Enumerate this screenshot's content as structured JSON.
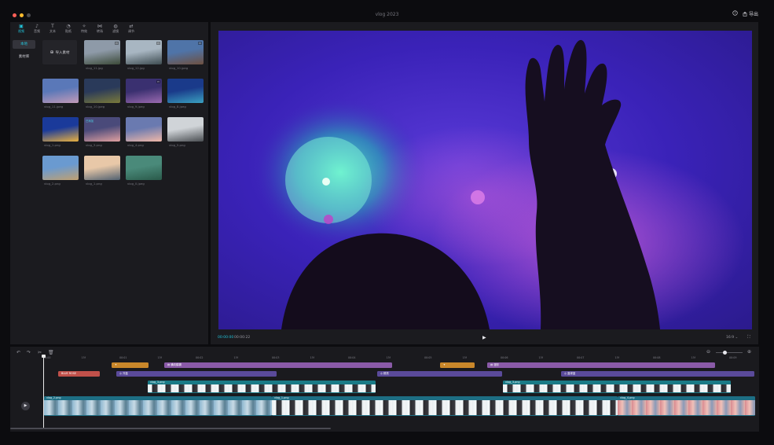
{
  "window": {
    "title": "vlog 2023",
    "help_icon": "question-icon",
    "export_label": "导出",
    "traffic_colors": [
      "#ff5f57",
      "#febc2e",
      "#4a4a4f"
    ]
  },
  "media": {
    "tools": [
      {
        "icon": "media-icon",
        "glyph": "▣",
        "label": "视频"
      },
      {
        "icon": "audio-icon",
        "glyph": "♪",
        "label": "音频"
      },
      {
        "icon": "text-icon",
        "glyph": "T",
        "label": "文本"
      },
      {
        "icon": "sticker-icon",
        "glyph": "◔",
        "label": "贴纸"
      },
      {
        "icon": "effects-icon",
        "glyph": "✧",
        "label": "特效"
      },
      {
        "icon": "transition-icon",
        "glyph": "⋈",
        "label": "转场"
      },
      {
        "icon": "filter-icon",
        "glyph": "◍",
        "label": "滤镜"
      },
      {
        "icon": "adjust-icon",
        "glyph": "⇄",
        "label": "调节"
      }
    ],
    "sidebar": [
      "本地",
      "素材库"
    ],
    "import_label": "导入素材",
    "thumbs": [
      {
        "name": "vlog_11.jpg",
        "c1": "#8e9aa8",
        "c2": "#3c4a38"
      },
      {
        "name": "vlog_12.jpg",
        "c1": "#a8b6c2",
        "c2": "#3d4b50"
      },
      {
        "name": "vlog_10.jpeg",
        "c1": "#4f74a8",
        "c2": "#6e5040"
      },
      {
        "name": "vlog_11.jpeg",
        "c1": "#5a78b8",
        "c2": "#c29ab8"
      },
      {
        "name": "vlog_10.jpeg",
        "c1": "#2a3a5a",
        "c2": "#7a7a3a"
      },
      {
        "name": "vlog_9.jpeg",
        "c1": "#3a3070",
        "c2": "#9a6ab0"
      },
      {
        "name": "vlog_8.jpeg",
        "c1": "#1a3a8a",
        "c2": "#3aa0c0"
      },
      {
        "name": "vlog_1.png",
        "c1": "#1a3a9a",
        "c2": "#e8b040"
      },
      {
        "name": "vlog_3.png",
        "c1": "#4a4a7a",
        "c2": "#e0a0a0"
      },
      {
        "name": "vlog_4.png",
        "c1": "#6a7ab0",
        "c2": "#f0b8a8"
      },
      {
        "name": "vlog_5.png",
        "c1": "#d0d4d8",
        "c2": "#4a4e52"
      },
      {
        "name": "vlog_2.png",
        "c1": "#6a9ad0",
        "c2": "#c0a070"
      },
      {
        "name": "vlog_1.png",
        "c1": "#e8c8a8",
        "c2": "#506070"
      },
      {
        "name": "vlog_0.jpeg",
        "c1": "#4a8a7a",
        "c2": "#2a5a4a"
      }
    ],
    "used_badge": "已添加"
  },
  "preview": {
    "time_current": "00:00:00",
    "time_total": "00:00:22",
    "ratio": "16:9",
    "play_icon": "play-icon",
    "fullscreen_icon": "fullscreen-icon"
  },
  "timeline": {
    "ruler": [
      "00:00",
      "15f",
      "00:01",
      "15f",
      "00:02",
      "15f",
      "00:03",
      "15f",
      "00:04",
      "15f",
      "00:05",
      "15f",
      "00:06",
      "15f",
      "00:07",
      "15f",
      "00:08",
      "15f",
      "00:09"
    ],
    "tracks": {
      "row1": [
        {
          "label": "✦",
          "color": "#c9872a"
        },
        {
          "label": "▤ 横向模糊",
          "color": "#8a5aa8"
        },
        {
          "label": "✦",
          "color": "#c9872a"
        },
        {
          "label": "▤ 漫彩",
          "color": "#8a5aa8"
        }
      ],
      "row2": [
        {
          "label": "BLUE ROSE",
          "color": "#c0504a"
        },
        {
          "label": "◎ 冷蓝",
          "color": "#5a4a9a"
        },
        {
          "label": "◎ 鲜亮",
          "color": "#5a4a9a"
        },
        {
          "label": "◎ 蓝绿蓝",
          "color": "#5a4a9a"
        }
      ],
      "row3": [
        {
          "label": "vlog_3.png",
          "color": "#1a7a86"
        },
        {
          "label": "vlog_3.png",
          "color": "#1a7a86"
        }
      ],
      "main": [
        {
          "label": "vlog_2.png",
          "color": "#1d6e84"
        },
        {
          "label": "vlog_1.png",
          "color": "#1d6e84"
        },
        {
          "label": "vlog_4.png",
          "color": "#1d6e84"
        }
      ]
    },
    "tools": [
      "undo-icon",
      "redo-icon",
      "split-icon",
      "delete-icon"
    ],
    "zoom_out_icon": "zoom-out-icon",
    "zoom_in_icon": "zoom-in-icon",
    "zoom_level": 0.35
  },
  "colors": {
    "accent": "#22c2d8"
  }
}
